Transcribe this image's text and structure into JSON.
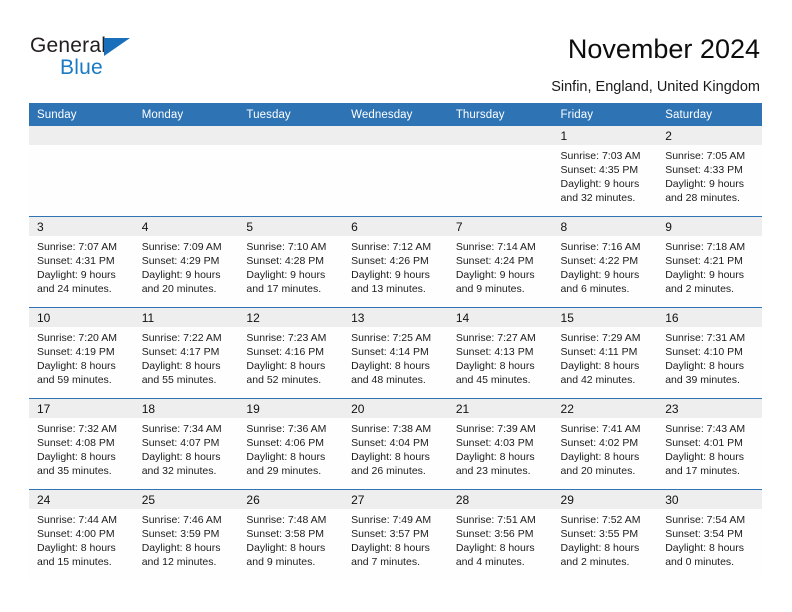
{
  "brand": {
    "name_top": "General",
    "name_bottom": "Blue",
    "accent_color": "#1a7ac4",
    "triangle_color": "#1a6fba"
  },
  "header": {
    "title": "November 2024",
    "subtitle": "Sinfin, England, United Kingdom",
    "header_bg_color": "#2e74b5",
    "header_text_color": "#ffffff"
  },
  "weekday_headers": [
    "Sunday",
    "Monday",
    "Tuesday",
    "Wednesday",
    "Thursday",
    "Friday",
    "Saturday"
  ],
  "labels": {
    "sunrise_prefix": "Sunrise:",
    "sunset_prefix": "Sunset:",
    "daylight_prefix": "Daylight:"
  },
  "calendar": {
    "month": "November",
    "year": "2024",
    "weeks": [
      [
        {
          "empty": true
        },
        {
          "empty": true
        },
        {
          "empty": true
        },
        {
          "empty": true
        },
        {
          "empty": true
        },
        {
          "day": "1",
          "sunrise": "Sunrise: 7:03 AM",
          "sunset": "Sunset: 4:35 PM",
          "daylight_line1": "Daylight: 9 hours",
          "daylight_line2": "and 32 minutes."
        },
        {
          "day": "2",
          "sunrise": "Sunrise: 7:05 AM",
          "sunset": "Sunset: 4:33 PM",
          "daylight_line1": "Daylight: 9 hours",
          "daylight_line2": "and 28 minutes."
        }
      ],
      [
        {
          "day": "3",
          "sunrise": "Sunrise: 7:07 AM",
          "sunset": "Sunset: 4:31 PM",
          "daylight_line1": "Daylight: 9 hours",
          "daylight_line2": "and 24 minutes."
        },
        {
          "day": "4",
          "sunrise": "Sunrise: 7:09 AM",
          "sunset": "Sunset: 4:29 PM",
          "daylight_line1": "Daylight: 9 hours",
          "daylight_line2": "and 20 minutes."
        },
        {
          "day": "5",
          "sunrise": "Sunrise: 7:10 AM",
          "sunset": "Sunset: 4:28 PM",
          "daylight_line1": "Daylight: 9 hours",
          "daylight_line2": "and 17 minutes."
        },
        {
          "day": "6",
          "sunrise": "Sunrise: 7:12 AM",
          "sunset": "Sunset: 4:26 PM",
          "daylight_line1": "Daylight: 9 hours",
          "daylight_line2": "and 13 minutes."
        },
        {
          "day": "7",
          "sunrise": "Sunrise: 7:14 AM",
          "sunset": "Sunset: 4:24 PM",
          "daylight_line1": "Daylight: 9 hours",
          "daylight_line2": "and 9 minutes."
        },
        {
          "day": "8",
          "sunrise": "Sunrise: 7:16 AM",
          "sunset": "Sunset: 4:22 PM",
          "daylight_line1": "Daylight: 9 hours",
          "daylight_line2": "and 6 minutes."
        },
        {
          "day": "9",
          "sunrise": "Sunrise: 7:18 AM",
          "sunset": "Sunset: 4:21 PM",
          "daylight_line1": "Daylight: 9 hours",
          "daylight_line2": "and 2 minutes."
        }
      ],
      [
        {
          "day": "10",
          "sunrise": "Sunrise: 7:20 AM",
          "sunset": "Sunset: 4:19 PM",
          "daylight_line1": "Daylight: 8 hours",
          "daylight_line2": "and 59 minutes."
        },
        {
          "day": "11",
          "sunrise": "Sunrise: 7:22 AM",
          "sunset": "Sunset: 4:17 PM",
          "daylight_line1": "Daylight: 8 hours",
          "daylight_line2": "and 55 minutes."
        },
        {
          "day": "12",
          "sunrise": "Sunrise: 7:23 AM",
          "sunset": "Sunset: 4:16 PM",
          "daylight_line1": "Daylight: 8 hours",
          "daylight_line2": "and 52 minutes."
        },
        {
          "day": "13",
          "sunrise": "Sunrise: 7:25 AM",
          "sunset": "Sunset: 4:14 PM",
          "daylight_line1": "Daylight: 8 hours",
          "daylight_line2": "and 48 minutes."
        },
        {
          "day": "14",
          "sunrise": "Sunrise: 7:27 AM",
          "sunset": "Sunset: 4:13 PM",
          "daylight_line1": "Daylight: 8 hours",
          "daylight_line2": "and 45 minutes."
        },
        {
          "day": "15",
          "sunrise": "Sunrise: 7:29 AM",
          "sunset": "Sunset: 4:11 PM",
          "daylight_line1": "Daylight: 8 hours",
          "daylight_line2": "and 42 minutes."
        },
        {
          "day": "16",
          "sunrise": "Sunrise: 7:31 AM",
          "sunset": "Sunset: 4:10 PM",
          "daylight_line1": "Daylight: 8 hours",
          "daylight_line2": "and 39 minutes."
        }
      ],
      [
        {
          "day": "17",
          "sunrise": "Sunrise: 7:32 AM",
          "sunset": "Sunset: 4:08 PM",
          "daylight_line1": "Daylight: 8 hours",
          "daylight_line2": "and 35 minutes."
        },
        {
          "day": "18",
          "sunrise": "Sunrise: 7:34 AM",
          "sunset": "Sunset: 4:07 PM",
          "daylight_line1": "Daylight: 8 hours",
          "daylight_line2": "and 32 minutes."
        },
        {
          "day": "19",
          "sunrise": "Sunrise: 7:36 AM",
          "sunset": "Sunset: 4:06 PM",
          "daylight_line1": "Daylight: 8 hours",
          "daylight_line2": "and 29 minutes."
        },
        {
          "day": "20",
          "sunrise": "Sunrise: 7:38 AM",
          "sunset": "Sunset: 4:04 PM",
          "daylight_line1": "Daylight: 8 hours",
          "daylight_line2": "and 26 minutes."
        },
        {
          "day": "21",
          "sunrise": "Sunrise: 7:39 AM",
          "sunset": "Sunset: 4:03 PM",
          "daylight_line1": "Daylight: 8 hours",
          "daylight_line2": "and 23 minutes."
        },
        {
          "day": "22",
          "sunrise": "Sunrise: 7:41 AM",
          "sunset": "Sunset: 4:02 PM",
          "daylight_line1": "Daylight: 8 hours",
          "daylight_line2": "and 20 minutes."
        },
        {
          "day": "23",
          "sunrise": "Sunrise: 7:43 AM",
          "sunset": "Sunset: 4:01 PM",
          "daylight_line1": "Daylight: 8 hours",
          "daylight_line2": "and 17 minutes."
        }
      ],
      [
        {
          "day": "24",
          "sunrise": "Sunrise: 7:44 AM",
          "sunset": "Sunset: 4:00 PM",
          "daylight_line1": "Daylight: 8 hours",
          "daylight_line2": "and 15 minutes."
        },
        {
          "day": "25",
          "sunrise": "Sunrise: 7:46 AM",
          "sunset": "Sunset: 3:59 PM",
          "daylight_line1": "Daylight: 8 hours",
          "daylight_line2": "and 12 minutes."
        },
        {
          "day": "26",
          "sunrise": "Sunrise: 7:48 AM",
          "sunset": "Sunset: 3:58 PM",
          "daylight_line1": "Daylight: 8 hours",
          "daylight_line2": "and 9 minutes."
        },
        {
          "day": "27",
          "sunrise": "Sunrise: 7:49 AM",
          "sunset": "Sunset: 3:57 PM",
          "daylight_line1": "Daylight: 8 hours",
          "daylight_line2": "and 7 minutes."
        },
        {
          "day": "28",
          "sunrise": "Sunrise: 7:51 AM",
          "sunset": "Sunset: 3:56 PM",
          "daylight_line1": "Daylight: 8 hours",
          "daylight_line2": "and 4 minutes."
        },
        {
          "day": "29",
          "sunrise": "Sunrise: 7:52 AM",
          "sunset": "Sunset: 3:55 PM",
          "daylight_line1": "Daylight: 8 hours",
          "daylight_line2": "and 2 minutes."
        },
        {
          "day": "30",
          "sunrise": "Sunrise: 7:54 AM",
          "sunset": "Sunset: 3:54 PM",
          "daylight_line1": "Daylight: 8 hours",
          "daylight_line2": "and 0 minutes."
        }
      ]
    ]
  }
}
